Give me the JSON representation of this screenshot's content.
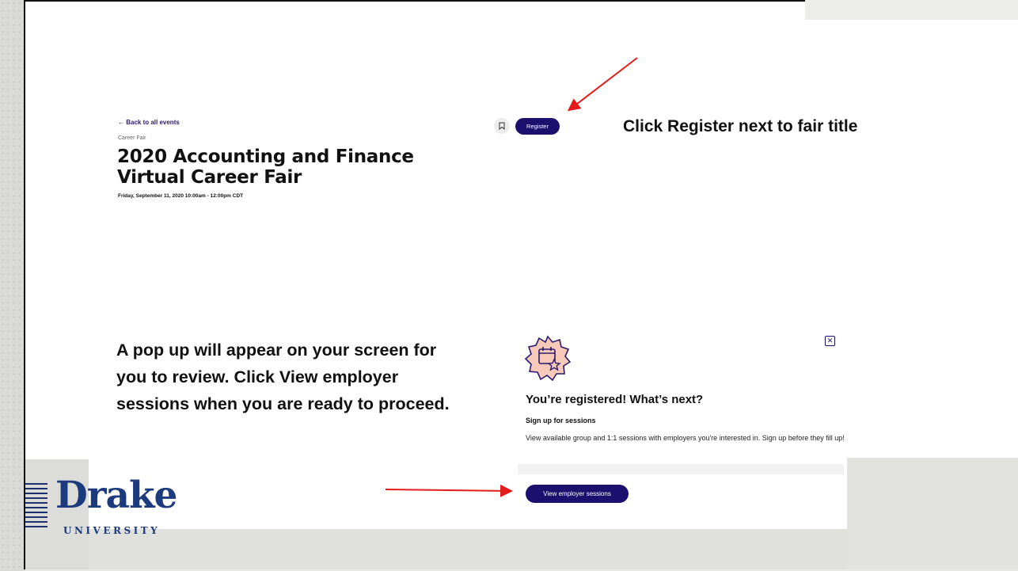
{
  "event": {
    "back_link": "← Back to all events",
    "category": "Career Fair",
    "title_line1": "2020 Accounting and Finance",
    "title_line2": "Virtual Career Fair",
    "date": "Friday, September 11, 2020 10:00am - 12:00pm CDT",
    "register_label": "Register"
  },
  "callouts": {
    "top": "Click Register next to fair title",
    "bottom": "A pop up will appear on your screen for you to review.  Click View employer sessions when you are ready to proceed."
  },
  "modal": {
    "heading": "You’re registered! What’s next?",
    "subheading": "Sign up for sessions",
    "body": "View available group and 1:1 sessions with employers you're interested in. Sign up before they fill up!",
    "button_label": "View employer sessions",
    "close_glyph": "✕"
  },
  "logo": {
    "word": "Drake",
    "sub": "UNIVERSITY"
  },
  "colors": {
    "primary": "#1c0f6e",
    "logo_blue": "#1c3a7e",
    "arrow_red": "#e41b1b"
  },
  "icons": {
    "bookmark": "bookmark-icon",
    "badge": "calendar-star-icon",
    "close": "close-icon"
  }
}
